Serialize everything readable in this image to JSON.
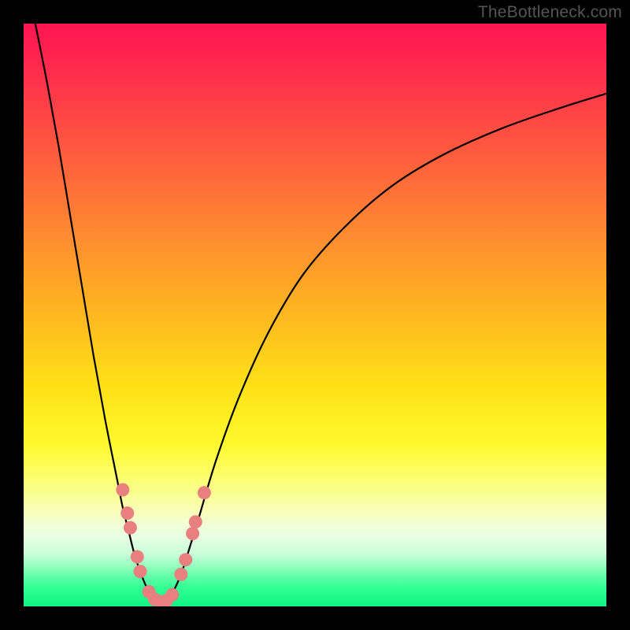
{
  "watermark": "TheBottleneck.com",
  "chart_data": {
    "type": "line",
    "title": "",
    "xlabel": "",
    "ylabel": "",
    "xlim": [
      0,
      100
    ],
    "ylim": [
      0,
      100
    ],
    "series": [
      {
        "name": "left-curve",
        "x": [
          2,
          4,
          6,
          8,
          10,
          12,
          14,
          16,
          17,
          18,
          19,
          20,
          21,
          22,
          23
        ],
        "y": [
          100,
          90,
          79,
          67,
          55,
          43,
          32,
          22,
          17,
          13,
          9,
          6,
          3.5,
          1.8,
          0.8
        ]
      },
      {
        "name": "right-curve",
        "x": [
          24,
          25,
          26,
          27,
          28,
          30,
          33,
          37,
          42,
          48,
          55,
          63,
          72,
          82,
          92,
          100
        ],
        "y": [
          0.8,
          1.6,
          3.2,
          5.5,
          8.5,
          15,
          25,
          36,
          47,
          57,
          65,
          72,
          77.5,
          82,
          85.5,
          88
        ]
      }
    ],
    "markers": {
      "name": "highlight-dots",
      "points": [
        {
          "x": 17.0,
          "y": 20.0
        },
        {
          "x": 17.8,
          "y": 16.0
        },
        {
          "x": 18.3,
          "y": 13.5
        },
        {
          "x": 19.5,
          "y": 8.5
        },
        {
          "x": 20.0,
          "y": 6.0
        },
        {
          "x": 21.5,
          "y": 2.5
        },
        {
          "x": 22.5,
          "y": 1.2
        },
        {
          "x": 23.5,
          "y": 0.8
        },
        {
          "x": 24.5,
          "y": 1.0
        },
        {
          "x": 25.5,
          "y": 2.0
        },
        {
          "x": 27.0,
          "y": 5.5
        },
        {
          "x": 27.8,
          "y": 8.0
        },
        {
          "x": 29.0,
          "y": 12.5
        },
        {
          "x": 29.5,
          "y": 14.5
        },
        {
          "x": 31.0,
          "y": 19.5
        }
      ]
    }
  }
}
